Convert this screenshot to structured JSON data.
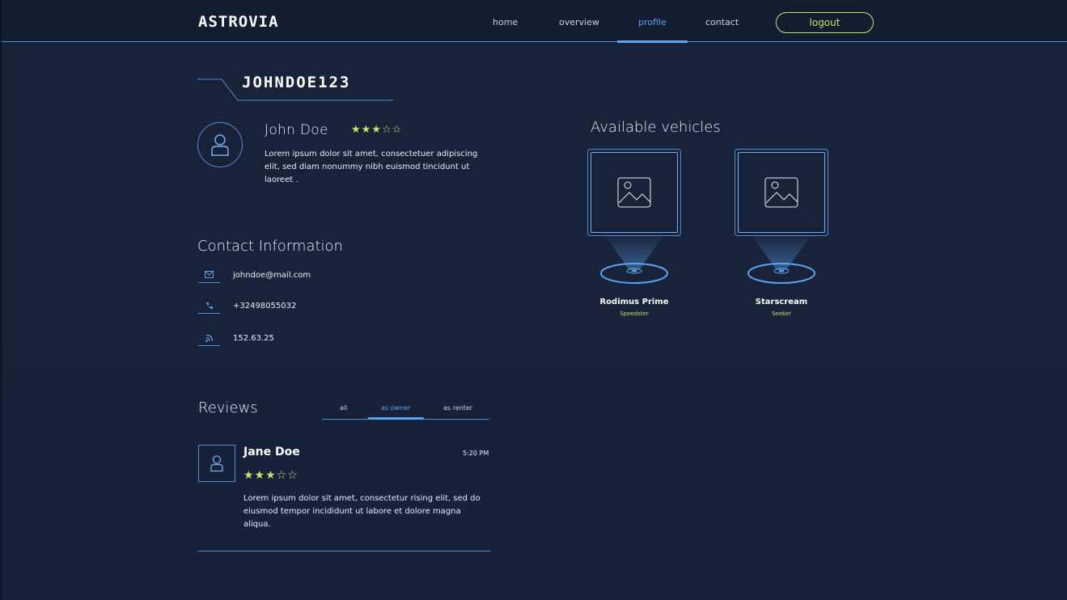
{
  "nav": {
    "logo": "ASTROVIA",
    "links": [
      {
        "label": "home"
      },
      {
        "label": "overview"
      },
      {
        "label": "profile"
      },
      {
        "label": "contact"
      }
    ],
    "active": "profile",
    "logout_label": "logout"
  },
  "profile": {
    "username": "JOHNDOE123",
    "full_name": "John Doe",
    "rating": 3,
    "rating_max": 5,
    "stars_text": "★★★☆☆",
    "bio": "Lorem ipsum dolor sit amet, consectetuer adipiscing elit, sed diam nonummy nibh euismod tincidunt ut laoreet ."
  },
  "contact": {
    "title": "Contact Information",
    "items": [
      {
        "icon": "mail-icon",
        "value": "johndoe@mail.com"
      },
      {
        "icon": "phone-icon",
        "value": "+32498055032"
      },
      {
        "icon": "rss-icon",
        "value": "152.63.25"
      }
    ]
  },
  "reviews": {
    "title": "Reviews",
    "tabs": [
      {
        "label": "all"
      },
      {
        "label": "as owner"
      },
      {
        "label": "as renter"
      }
    ],
    "active_tab": "as owner",
    "items": [
      {
        "name": "Jane Doe",
        "time": "5:20 PM",
        "rating": 3,
        "stars_text": "★★★☆☆",
        "text": "Lorem ipsum dolor sit amet, consectetur rising elit, sed do eiusmod tempor incididunt ut labore et dolore magna aliqua."
      }
    ]
  },
  "vehicles": {
    "title": "Available vehicles",
    "items": [
      {
        "name": "Rodimus Prime",
        "type": "Speedster"
      },
      {
        "name": "Starscream",
        "type": "Seeker"
      }
    ]
  },
  "colors": {
    "background": "#172139",
    "accent": "#5aa3f0",
    "line": "#4f8ed9",
    "highlight": "#c3e36c"
  }
}
